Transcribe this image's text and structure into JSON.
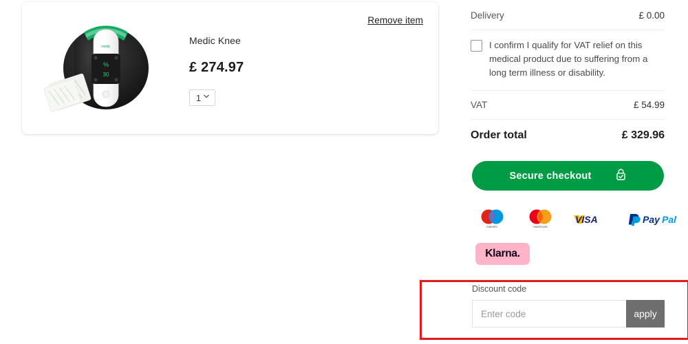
{
  "cart": {
    "remove_label": "Remove item",
    "product": {
      "title": "Medic Knee",
      "price": "£ 274.97",
      "quantity": "1",
      "image_name": "knee-device-product-image"
    }
  },
  "summary": {
    "delivery_label": "Delivery",
    "delivery_value": "£ 0.00",
    "vat_relief_text": "I confirm I qualify for VAT relief on this medical product due to suffering from a long term illness or disability.",
    "vat_relief_checked": false,
    "vat_label": "VAT",
    "vat_value": "£ 54.99",
    "total_label": "Order total",
    "total_value": "£ 329.96"
  },
  "checkout": {
    "label": "Secure checkout",
    "icon": "lock-check-icon",
    "color": "#009b45"
  },
  "payments": {
    "methods": [
      {
        "name": "maestro",
        "label": "maestro"
      },
      {
        "name": "mastercard",
        "label": "mastercard"
      },
      {
        "name": "visa",
        "label": "VISA"
      },
      {
        "name": "paypal",
        "label": "PayPal"
      }
    ],
    "klarna_label": "Klarna.",
    "klarna_bg": "#ffb3c7"
  },
  "discount": {
    "label": "Discount code",
    "placeholder": "Enter code",
    "value": "",
    "apply_label": "apply"
  },
  "annotation": {
    "highlight_color": "#e31a1a"
  }
}
